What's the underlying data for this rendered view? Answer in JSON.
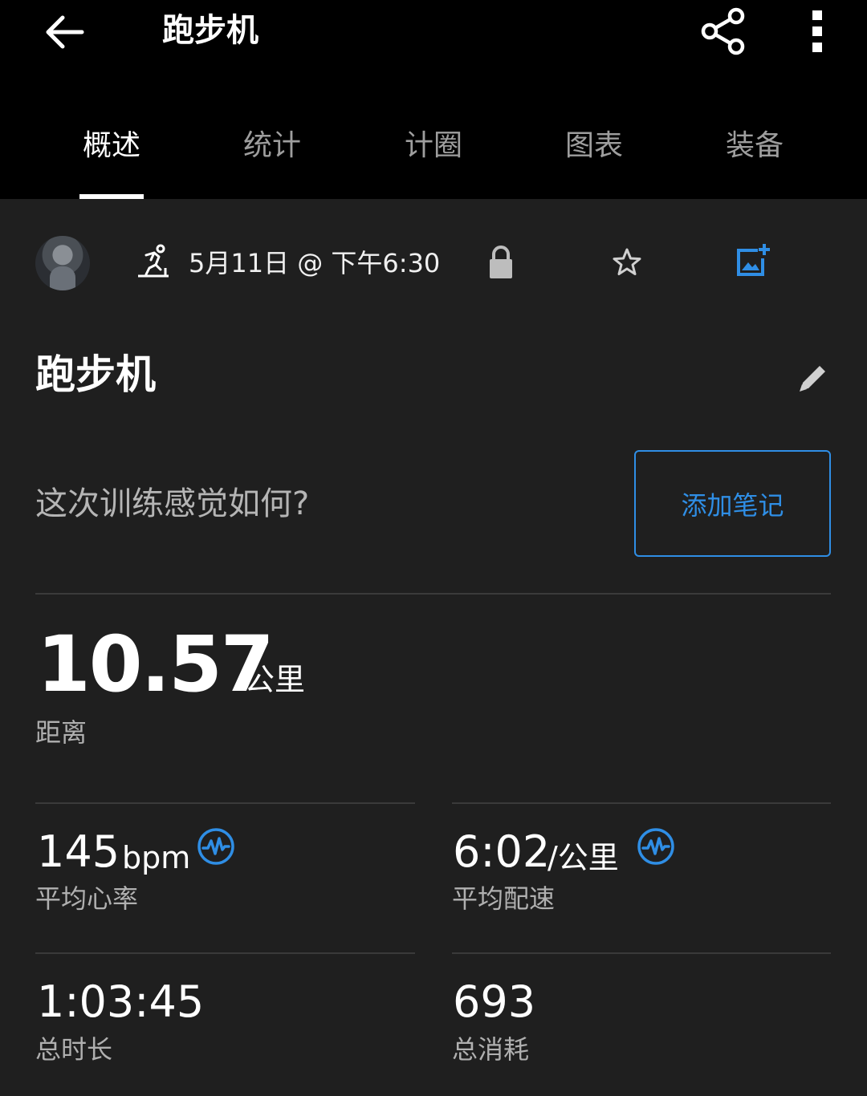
{
  "header": {
    "title": "跑步机",
    "back_icon": "arrow-left-icon",
    "share_icon": "share-icon",
    "more_icon": "more-vertical-icon"
  },
  "tabs": [
    {
      "label": "概述",
      "active": true
    },
    {
      "label": "统计",
      "active": false
    },
    {
      "label": "计圈",
      "active": false
    },
    {
      "label": "图表",
      "active": false
    },
    {
      "label": "装备",
      "active": false
    }
  ],
  "meta": {
    "activity_icon": "treadmill-run-icon",
    "date": "5月11日 @ 下午6:30",
    "privacy_icon": "lock-icon",
    "favorite_icon": "star-outline-icon",
    "photo_icon": "add-photo-icon"
  },
  "activity": {
    "title": "跑步机",
    "edit_icon": "pencil-icon",
    "feel_question": "这次训练感觉如何?",
    "add_note_label": "添加笔记"
  },
  "distance": {
    "value": "10.57",
    "unit": "公里",
    "label": "距离"
  },
  "stats": {
    "avg_hr": {
      "value": "145",
      "unit": "bpm",
      "label": "平均心率"
    },
    "avg_pace": {
      "value": "6:02",
      "unit": "/公里",
      "label": "平均配速"
    },
    "total_time": {
      "value": "1:03:45",
      "label": "总时长"
    },
    "calories": {
      "value": "693",
      "label": "总消耗"
    }
  },
  "colors": {
    "accent": "#2f8ee5",
    "background": "#1f1f1f",
    "header": "#000000"
  }
}
